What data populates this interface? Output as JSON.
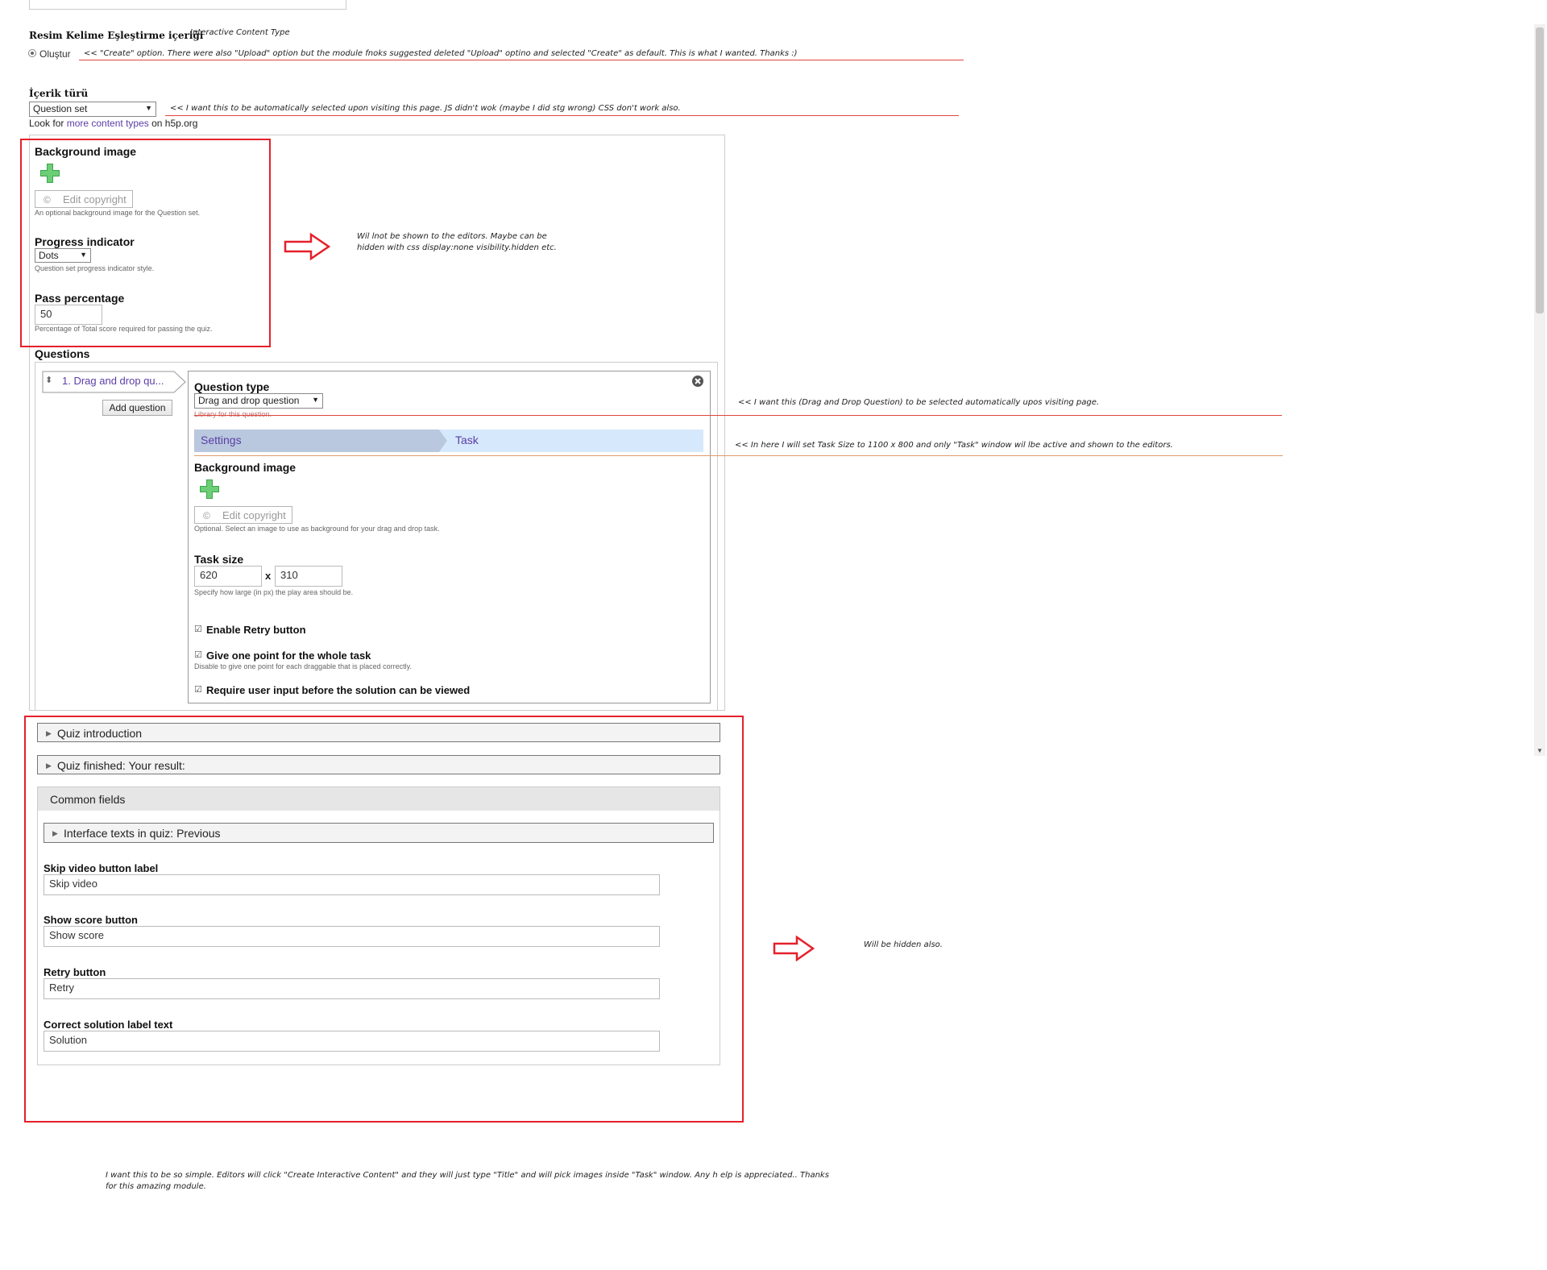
{
  "content": {
    "heading": "Resim Kelime Eşleştirme içeriği",
    "type_note": "Interactive Content Type",
    "radio_label": "Oluştur",
    "radio_note": "<<  \"Create\" option. There were also \"Upload\" option but the module fnoks suggested deleted \"Upload\" optino and selected \"Create\" as default. This is what I wanted. Thanks :)"
  },
  "content_type": {
    "label": "İçerik türü",
    "selected": "Question set",
    "note": "<<   I want this to be automatically selected upon visiting this page. JS didn't wok (maybe I did stg wrong) CSS don't work also.",
    "look_prefix": "Look for ",
    "look_link": "more content types",
    "look_suffix": " on h5p.org"
  },
  "questionset": {
    "bg_label": "Background image",
    "edit_copyright": "Edit copyright",
    "bg_desc": "An optional background image for the Question set.",
    "progress_label": "Progress indicator",
    "progress_value": "Dots",
    "progress_desc": "Question set progress indicator style.",
    "pass_label": "Pass percentage",
    "pass_value": "50",
    "pass_desc": "Percentage of Total score required for passing the quiz.",
    "hidden_note_1": "Wil lnot be shown to the editors. Maybe can be",
    "hidden_note_2": "hidden with css display:none visibility.hidden etc.",
    "questions_label": "Questions"
  },
  "question": {
    "list_item": "1. Drag and drop qu...",
    "add_button": "Add question",
    "type_label": "Question type",
    "type_value": "Drag and drop question",
    "type_desc": "Library for this question.",
    "type_note": "<< I want this (Drag and Drop Question) to be selected automatically upos visiting page.",
    "tab_settings": "Settings",
    "tab_task": "Task",
    "tab_note": "<< In here I will set Task Size to 1100 x 800 and only \"Task\"  window wil lbe active and shown to the editors.",
    "bg_label": "Background image",
    "edit_copyright": "Edit copyright",
    "bg_desc": "Optional. Select an image to use as background for your drag and drop task.",
    "size_label": "Task size",
    "width": "620",
    "x": "x",
    "height": "310",
    "size_desc": "Specify how large (in px) the play area should be.",
    "retry_label": "Enable Retry button",
    "onepoint_label": "Give one point for the whole task",
    "onepoint_desc": "Disable to give one point for each draggable that is placed correctly.",
    "require_label": "Require user input before the solution can be viewed"
  },
  "quiz": {
    "intro": "Quiz introduction",
    "finished": "Quiz finished: Your result:",
    "common": "Common fields",
    "interface": "Interface texts in quiz: Previous",
    "skip_label": "Skip video button label",
    "skip_value": "Skip video",
    "show_label": "Show score button",
    "show_value": "Show score",
    "retry_label": "Retry button",
    "retry_value": "Retry",
    "solution_label": "Correct solution label text",
    "solution_value": "Solution",
    "hidden_note": "Will be hidden also."
  },
  "footer_note_1": "I want this to be so simple. Editors will click \"Create Interactive Content\" and they will just type \"Title\" and will pick images inside \"Task\" window. Any h elp is appreciated.. Thanks",
  "footer_note_2": "for this amazing module.",
  "colors": {
    "red": "#e5202a",
    "link": "#5b3da6",
    "tab_settings": "#b9c8de",
    "tab_task": "#d6e8fb"
  }
}
